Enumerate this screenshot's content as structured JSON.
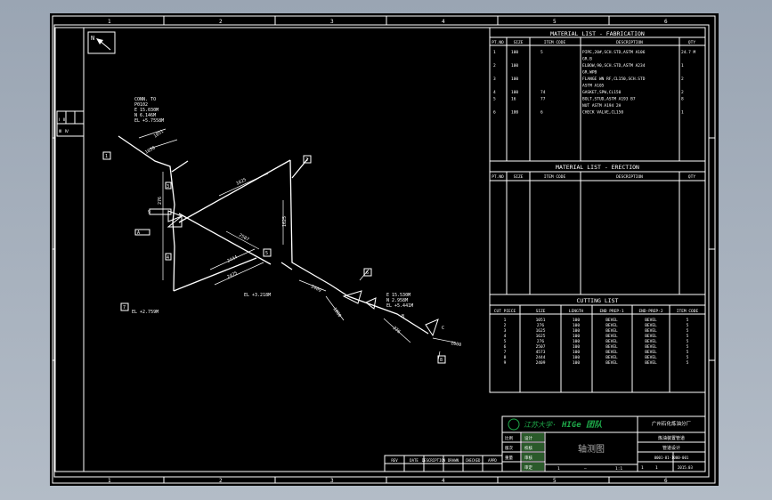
{
  "border_zone_labels": {
    "top": [
      "1",
      "2",
      "3",
      "4",
      "5",
      "6"
    ],
    "bottom": [
      "1",
      "2",
      "3",
      "4",
      "5",
      "6"
    ]
  },
  "north_arrow": {
    "label": "N",
    "icon": "north-arrow-icon"
  },
  "left_stamp": {
    "rows": [
      "Ⅰ Ⅱ",
      "Ⅲ Ⅳ"
    ]
  },
  "drawing_notes": {
    "top_left": [
      "CONN. TO",
      "P0102",
      "E 15.030M",
      "N 6.146M",
      "EL +5.7558M"
    ],
    "mid": [
      "E 15.530M",
      "N 2.958M",
      "EL +5.441M"
    ],
    "el_bottom": "EL +2.759M",
    "el_mid": "EL +3.218M"
  },
  "pipe_dimensions": [
    "1051",
    "1050",
    "276",
    "1625",
    "2507",
    "2444",
    "2475",
    "1625",
    "2409",
    "1000",
    "276",
    "1000"
  ],
  "callouts": [
    "1",
    "2",
    "3",
    "4",
    "5",
    "6",
    "7",
    "8",
    "9",
    "A",
    "B",
    "C"
  ],
  "fabrication_list": {
    "title": "MATERIAL LIST - FABRICATION",
    "headers": [
      "PT.NO",
      "SIZE",
      "ITEM CODE",
      "DESCRIPTION",
      "QTY"
    ],
    "rows": [
      [
        "1",
        "100",
        "5",
        "PIPE,20#,SCH.STD,ASTM A106",
        "24.7 M"
      ],
      [
        "",
        "",
        "",
        "GR.B",
        ""
      ],
      [
        "2",
        "100",
        "",
        "ELBOW,90,SCH.STD,ASTM A234",
        "1"
      ],
      [
        "",
        "",
        "",
        "GR.WPB",
        ""
      ],
      [
        "3",
        "100",
        "",
        "FLANGE WN RF,CL150,SCH.STD",
        "2"
      ],
      [
        "",
        "",
        "",
        "ASTM A105",
        ""
      ],
      [
        "4",
        "100",
        "74",
        "GASKET,SPW,CL150",
        "2"
      ],
      [
        "5",
        "16",
        "77",
        "BOLT,STUD,ASTM A193 B7",
        "8"
      ],
      [
        "",
        "",
        "",
        "NUT ASTM A194 2H",
        ""
      ],
      [
        "6",
        "100",
        "6",
        "CHECK VALVE,CL150",
        "1"
      ]
    ]
  },
  "erection_list": {
    "title": "MATERIAL LIST - ERECTION",
    "headers": [
      "PT.NO",
      "SIZE",
      "ITEM CODE",
      "DESCRIPTION",
      "QTY"
    ],
    "rows": []
  },
  "cutting_list": {
    "title": "CUTTING LIST",
    "headers": [
      "CUT PIECE",
      "SIZE",
      "LENGTH",
      "END PREP-1",
      "END-PREP-2",
      "ITEM CODE"
    ],
    "rows": [
      [
        "1",
        "1051",
        "100",
        "BEVEL",
        "BEVEL",
        "5"
      ],
      [
        "2",
        "276",
        "100",
        "BEVEL",
        "BEVEL",
        "5"
      ],
      [
        "3",
        "1625",
        "100",
        "BEVEL",
        "BEVEL",
        "5"
      ],
      [
        "4",
        "1625",
        "100",
        "BEVEL",
        "BEVEL",
        "5"
      ],
      [
        "5",
        "276",
        "100",
        "BEVEL",
        "BEVEL",
        "5"
      ],
      [
        "6",
        "2507",
        "100",
        "BEVEL",
        "BEVEL",
        "5"
      ],
      [
        "7",
        "4573",
        "100",
        "BEVEL",
        "BEVEL",
        "5"
      ],
      [
        "8",
        "2444",
        "100",
        "BEVEL",
        "BEVEL",
        "5"
      ],
      [
        "9",
        "2409",
        "100",
        "BEVEL",
        "BEVEL",
        "5"
      ]
    ]
  },
  "title_block": {
    "school": "江苏大学·",
    "team": "HIGe 团队",
    "company": "广州石化炼油分厂",
    "drawing_title": "轴测图",
    "project": "炼油装置管道",
    "project2": "管道设计",
    "drawing_no": "0001-01-1000-001",
    "sheet": "1",
    "of_sheets": "1",
    "sign_labels": [
      "设计",
      "校核",
      "审核",
      "审定"
    ],
    "scale_label": "比例",
    "rev_label": "版次",
    "weight_label": "重量",
    "bottom_cells": [
      "1",
      "—",
      "1:1"
    ],
    "date": "2015.03",
    "rev_headers": [
      "REV",
      "DATE",
      "DESCRIPTION",
      "DRAWN",
      "CHECKED",
      "APPD"
    ]
  }
}
